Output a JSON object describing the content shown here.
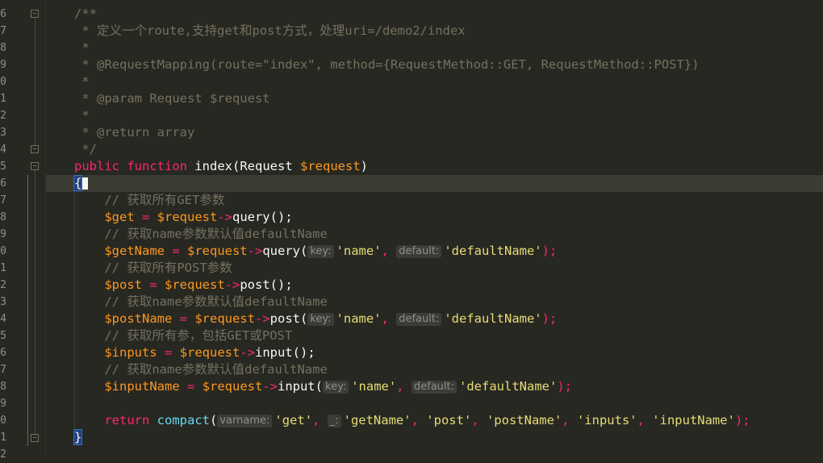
{
  "gutter": {
    "line_numbers": [
      "6",
      "7",
      "8",
      "9",
      "0",
      "1",
      "2",
      "3",
      "4",
      "5",
      "6",
      "7",
      "8",
      "9",
      "0",
      "1",
      "2",
      "3",
      "4",
      "5",
      "6",
      "7",
      "8",
      "9",
      "0",
      "1",
      "2"
    ]
  },
  "code": {
    "doc_open": "/**",
    "doc_desc": " * 定义一个route,支持get和post方式，处理uri=/demo2/index",
    "doc_blank1": " *",
    "doc_mapping": " * @RequestMapping(route=\"index\", method={RequestMethod::GET, RequestMethod::POST})",
    "doc_blank2": " *",
    "doc_param": " * @param Request $request",
    "doc_blank3": " *",
    "doc_return": " * @return array",
    "doc_close": " */",
    "sig": {
      "kw_public": "public",
      "kw_function": "function",
      "name": "index",
      "paren_open": "(Request ",
      "param": "$request",
      "paren_close": ")"
    },
    "brace_open": "{",
    "brace_close": "}",
    "comment_get_all": "// 获取所有GET参数",
    "comment_get_name": "// 获取name参数默认值defaultName",
    "comment_post_all": "// 获取所有POST参数",
    "comment_post_name": "// 获取name参数默认值defaultName",
    "comment_inputs_all": "// 获取所有参，包括GET或POST",
    "comment_input_name": "// 获取name参数默认值defaultName",
    "var_get": "$get",
    "var_getName": "$getName",
    "var_post": "$post",
    "var_postName": "$postName",
    "var_inputs": "$inputs",
    "var_inputName": "$inputName",
    "var_request": "$request",
    "assign": " = ",
    "arrow": "->",
    "m_query": "query",
    "m_post": "post",
    "m_input": "input",
    "empty_call": "();",
    "open_paren": "(",
    "close_stmt": ");",
    "comma": ", ",
    "hint_key": "key:",
    "hint_default": "default:",
    "hint_varname": "varname:",
    "hint_underscore": "_:",
    "str_name": "'name'",
    "str_defaultName": "'defaultName'",
    "kw_return": "return",
    "fn_compact": "compact",
    "str_get": "'get'",
    "str_getName": "'getName'",
    "str_post": "'post'",
    "str_postName": "'postName'",
    "str_inputs": "'inputs'",
    "str_inputName": "'inputName'"
  },
  "colors": {
    "background": "#272822",
    "comment": "#75715e",
    "keyword": "#f92672",
    "function": "#a6e22e",
    "variable": "#fd971f",
    "string": "#e6db74",
    "builtin": "#66d9ef"
  }
}
